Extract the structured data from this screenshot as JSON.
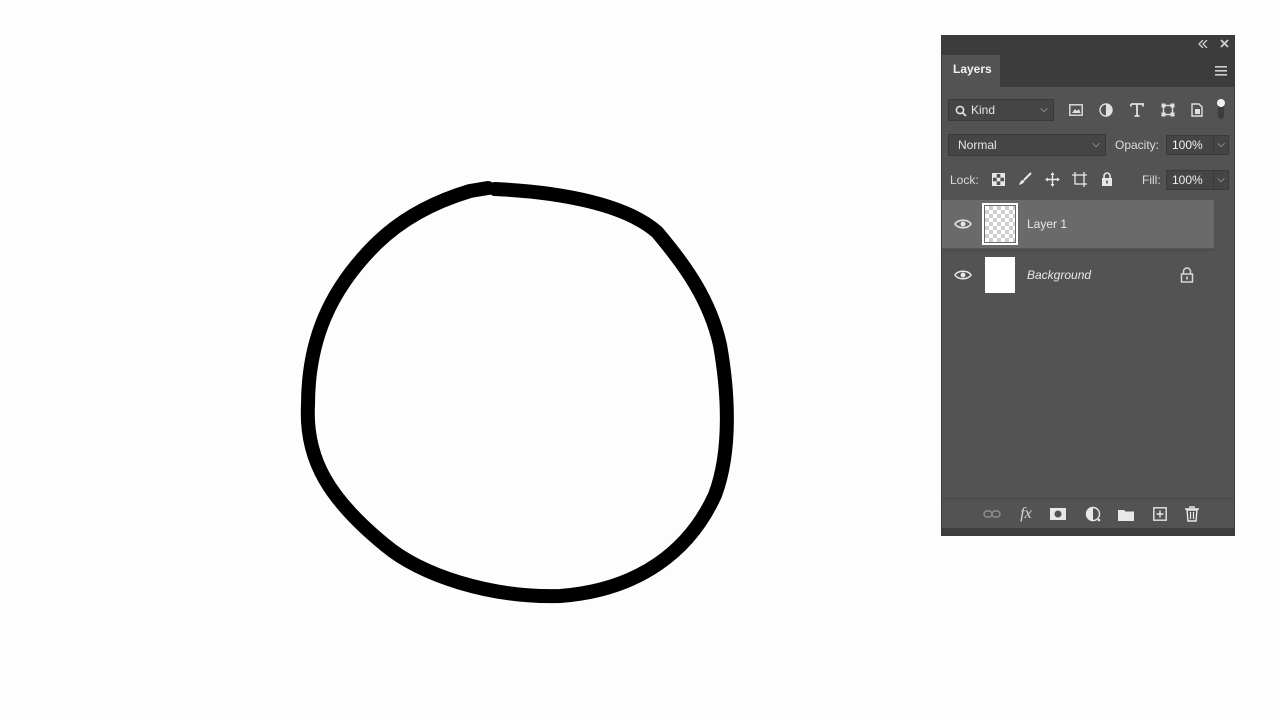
{
  "canvas": {
    "background": "#fdfdfd",
    "stroke_color": "#000000"
  },
  "panel": {
    "tab_label": "Layers",
    "collapse_icon": "double-chevron-left-icon",
    "close_icon": "close-icon",
    "menu_icon": "hamburger-menu-icon",
    "filter": {
      "kind_label": "Kind",
      "icons": [
        "image-filter-icon",
        "adjustment-filter-icon",
        "type-filter-icon",
        "shape-filter-icon",
        "smart-object-filter-icon"
      ]
    },
    "blend_mode": "Normal",
    "opacity_label": "Opacity:",
    "opacity_value": "100%",
    "lock_label": "Lock:",
    "lock_icons": [
      "lock-transparent-pixels-icon",
      "lock-image-pixels-icon",
      "lock-position-icon",
      "lock-artboard-icon",
      "lock-all-icon"
    ],
    "fill_label": "Fill:",
    "fill_value": "100%",
    "layers": [
      {
        "name": "Layer 1",
        "selected": true,
        "visible": true,
        "locked": false
      },
      {
        "name": "Background",
        "selected": false,
        "visible": true,
        "locked": true
      }
    ],
    "bottom_icons": [
      "link-layers-icon",
      "fx-icon",
      "layer-mask-icon",
      "adjustment-layer-icon",
      "new-group-icon",
      "new-layer-icon",
      "delete-layer-icon"
    ],
    "fx_label": "fx",
    "colors": {
      "panel_bg": "#535353",
      "header_bg": "#3c3c3c",
      "selected_row": "#6a6a6a"
    }
  }
}
